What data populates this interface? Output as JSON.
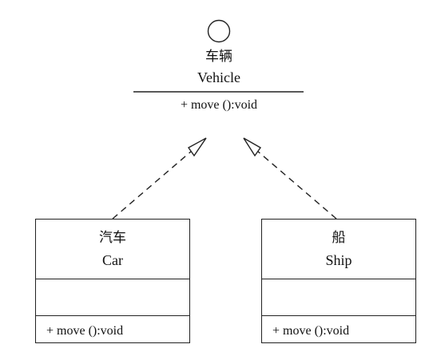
{
  "interface": {
    "name_cn": "车辆",
    "name_en": "Vehicle",
    "operation": "+ move ():void"
  },
  "classes": [
    {
      "id": "car",
      "name_cn": "汽车",
      "name_en": "Car",
      "operation": "+ move ():void"
    },
    {
      "id": "ship",
      "name_cn": "船",
      "name_en": "Ship",
      "operation": "+ move ():void"
    }
  ],
  "relations": [
    {
      "from": "car",
      "to": "interface",
      "type": "realization"
    },
    {
      "from": "ship",
      "to": "interface",
      "type": "realization"
    }
  ]
}
